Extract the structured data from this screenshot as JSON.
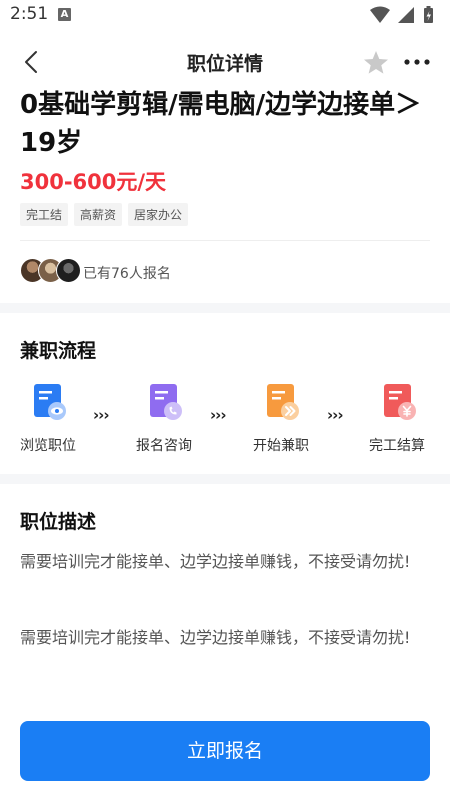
{
  "status_bar": {
    "time": "2:51",
    "notification_glyph": "A"
  },
  "nav": {
    "title": "职位详情"
  },
  "job": {
    "title": "0基础学剪辑/需电脑/边学边接单＞19岁",
    "salary": "300-600元/天",
    "tags": [
      "完工结",
      "高薪资",
      "居家办公"
    ],
    "applicants_text": "已有76人报名"
  },
  "process": {
    "title": "兼职流程",
    "steps": [
      {
        "label": "浏览职位",
        "icon": "browse-icon",
        "color": "#2b7cf3"
      },
      {
        "label": "报名咨询",
        "icon": "consult-icon",
        "color": "#8f6cf0"
      },
      {
        "label": "开始兼职",
        "icon": "start-icon",
        "color": "#f79a3e"
      },
      {
        "label": "完工结算",
        "icon": "settle-icon",
        "color": "#f05a5a"
      }
    ],
    "arrow": "›››"
  },
  "description": {
    "title": "职位描述",
    "paragraphs": [
      "需要培训完才能接单、边学边接单赚钱，不接受请勿扰!",
      "需要培训完才能接单、边学边接单赚钱，不接受请勿扰!"
    ]
  },
  "apply_button": {
    "label": "立即报名"
  },
  "colors": {
    "accent": "#1a7ef4",
    "salary": "#f0323c"
  }
}
